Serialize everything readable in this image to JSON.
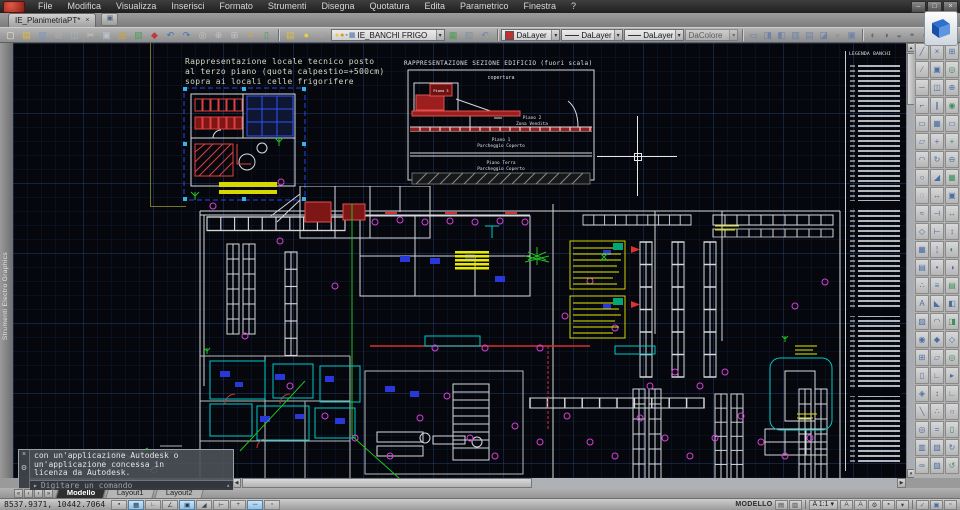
{
  "window": {
    "controls": [
      {
        "name": "minimize-button",
        "g": "–"
      },
      {
        "name": "restore-button",
        "g": "□"
      },
      {
        "name": "close-button",
        "g": "×"
      }
    ]
  },
  "menu_bar": {
    "items": [
      "File",
      "Modifica",
      "Visualizza",
      "Inserisci",
      "Formato",
      "Strumenti",
      "Disegna",
      "Quotatura",
      "Edita",
      "Parametrico",
      "Finestra",
      "?"
    ]
  },
  "document_tabs": {
    "active": "IE_PlanimetriaPT*",
    "close_glyph": "×"
  },
  "toolbar": {
    "standard_icons": [
      {
        "name": "qnew-icon",
        "g": "▢",
        "c": "#e9e5cf"
      },
      {
        "name": "open-icon",
        "g": "▤",
        "c": "#dfb93e"
      },
      {
        "name": "save-icon",
        "g": "▥",
        "c": "#7f95c4"
      },
      {
        "name": "plot-icon",
        "g": "⊟",
        "c": "#a9b0b8"
      },
      {
        "name": "plot-preview-icon",
        "g": "◫",
        "c": "#9fb4c8"
      },
      {
        "name": "cut-icon",
        "g": "✂",
        "c": "#c2c8ce"
      },
      {
        "name": "copy-icon",
        "g": "▣",
        "c": "#b9c2cb"
      },
      {
        "name": "paste-icon",
        "g": "▨",
        "c": "#c8a24a"
      },
      {
        "name": "match-properties-icon",
        "g": "▧",
        "c": "#4f9e58"
      },
      {
        "name": "block-editor-icon",
        "g": "◆",
        "c": "#c03838"
      },
      {
        "name": "undo-icon",
        "g": "↶",
        "c": "#3f6fb5"
      },
      {
        "name": "redo-icon",
        "g": "↷",
        "c": "#3f6fb5"
      },
      {
        "name": "pan-icon",
        "g": "◎",
        "c": "#c0c6cc"
      },
      {
        "name": "zoom-realtime-icon",
        "g": "⊕",
        "c": "#bfc5cb"
      },
      {
        "name": "zoom-window-icon",
        "g": "⊞",
        "c": "#bfc5cb"
      },
      {
        "name": "properties-icon",
        "g": "≡",
        "c": "#caa93f"
      },
      {
        "name": "tool-palettes-icon",
        "g": "▯",
        "c": "#4f9e58"
      }
    ],
    "layer_tools": [
      {
        "name": "layer-properties-manager-icon",
        "g": "▤",
        "c": "#d8c040"
      },
      {
        "name": "layer-bulb-icon",
        "g": "●",
        "c": "#e8d040"
      },
      {
        "name": "layer-isolate-icon",
        "g": "◐",
        "c": "#98a8b8"
      }
    ],
    "layer_dropdown": {
      "status_icons": [
        {
          "name": "layer-on-icon",
          "g": "●",
          "c": "#e8c83c"
        },
        {
          "name": "layer-freeze-icon",
          "g": "●",
          "c": "#e89020"
        },
        {
          "name": "layer-lock-icon",
          "g": "▪",
          "c": "#8a93a0"
        },
        {
          "name": "layer-color-chip",
          "g": "▦",
          "c": "#4a6fa5"
        }
      ],
      "current": "IE_BANCHI FRIGO"
    },
    "layer_tools2": [
      {
        "name": "make-object-layer-current-icon",
        "g": "▦",
        "c": "#4f9e58"
      },
      {
        "name": "layer-match-icon",
        "g": "▧",
        "c": "#8090a0"
      },
      {
        "name": "layer-previous-icon",
        "g": "↶",
        "c": "#7080b0"
      }
    ],
    "properties": {
      "color_swatch": "#c03030",
      "color": "DaLayer",
      "linetype": "DaLayer",
      "lineweight": "DaLayer",
      "plot_style": "DaColore"
    },
    "property_icons": [
      {
        "name": "pline-edit-icon",
        "g": "▭",
        "c": "#6f82a8"
      },
      {
        "name": "edit-hatch-icon",
        "g": "◨",
        "c": "#6f82a8"
      },
      {
        "name": "edit-text-icon",
        "g": "◧",
        "c": "#6f82a8"
      },
      {
        "name": "edit-attrib-icon",
        "g": "▥",
        "c": "#6f82a8"
      },
      {
        "name": "edit-block-icon",
        "g": "▤",
        "c": "#6f82a8"
      },
      {
        "name": "edit-xref-icon",
        "g": "◪",
        "c": "#6f82a8"
      },
      {
        "name": "edit-image-icon",
        "g": "▫",
        "c": "#6f82a8"
      },
      {
        "name": "edit-layout-icon",
        "g": "▣",
        "c": "#6f82a8"
      }
    ],
    "right_buttons": [
      {
        "name": "view-top-button",
        "g": "◐",
        "c": "#5a6a7a"
      },
      {
        "name": "view-bottom-button",
        "g": "◑",
        "c": "#5a6a7a"
      },
      {
        "name": "view-left-button",
        "g": "◒",
        "c": "#5a6a7a"
      },
      {
        "name": "view-right-button",
        "g": "◓",
        "c": "#5a6a7a"
      },
      {
        "name": "view-sw-button",
        "g": "○",
        "c": "#5a6a7a"
      },
      {
        "name": "view-se-button",
        "g": "●",
        "c": "#5a6a7a"
      },
      {
        "name": "view-iso-button",
        "g": "▫",
        "c": "#5a6a7a"
      }
    ]
  },
  "left_dock": {
    "title": "Strumenti Electro Graphics"
  },
  "canvas": {
    "annotation": {
      "lines": [
        "Rappresentazione locale tecnico posto",
        "al terzo piano (quota calpestio=+500cm)",
        "sopra ai locali celle frigorifere"
      ]
    },
    "section": {
      "title": "RAPPRESENTAZIONE SEZIONE EDIFICIO (fuori scala)",
      "copertura": "copertura",
      "piano3": "Piano 3",
      "piano2_l1": "Piano 2",
      "piano2_l2": "Zona Vendita",
      "piano1_l1": "Piano 1",
      "piano1_l2": "Parcheggio Coperto",
      "terra_l1": "Piano Terra",
      "terra_l2": "Parcheggio Coperto"
    },
    "legend": {
      "title": "LEGENDA BANCHI"
    },
    "command_window": {
      "lines": [
        "con un'applicazione Autodesk o",
        "un'applicazione concessa in",
        "licenza da Autodesk."
      ],
      "prompt": "Digitare un comando"
    }
  },
  "right_toolbars": {
    "col_draw": [
      {
        "n": "draw-line-icon",
        "g": "╱"
      },
      {
        "n": "draw-xline-icon",
        "g": "∕"
      },
      {
        "n": "draw-ray-icon",
        "g": "─"
      },
      {
        "n": "draw-polyline-icon",
        "g": "⌐"
      },
      {
        "n": "draw-rectangle-icon",
        "g": "▭"
      },
      {
        "n": "draw-polygon-icon",
        "g": "▱"
      },
      {
        "n": "draw-arc-icon",
        "g": "◠"
      },
      {
        "n": "draw-circle-icon",
        "g": "○"
      },
      {
        "n": "draw-revcloud-icon",
        "g": "◌"
      },
      {
        "n": "draw-spline-icon",
        "g": "≈"
      },
      {
        "n": "draw-ellipse-icon",
        "g": "◇"
      },
      {
        "n": "draw-hatch-icon",
        "g": "▦"
      },
      {
        "n": "draw-gradient-icon",
        "g": "▤"
      },
      {
        "n": "draw-point-icon",
        "g": "∴"
      },
      {
        "n": "draw-text-icon",
        "g": "A"
      },
      {
        "n": "draw-table-icon",
        "g": "▨"
      },
      {
        "n": "draw-donut-icon",
        "g": "◉"
      },
      {
        "n": "insert-block-icon",
        "g": "⊞"
      },
      {
        "n": "make-block-icon",
        "g": "▯"
      },
      {
        "n": "draw-region-icon",
        "g": "◈"
      },
      {
        "n": "draw-mline-icon",
        "g": "╲"
      },
      {
        "n": "draw-boundary-icon",
        "g": "◎"
      },
      {
        "n": "draw-wipeout-icon",
        "g": "▥"
      },
      {
        "n": "draw-helix-icon",
        "g": "∞"
      }
    ],
    "col_modify": [
      {
        "n": "erase-icon",
        "g": "×"
      },
      {
        "n": "copy-object-icon",
        "g": "▣"
      },
      {
        "n": "mirror-icon",
        "g": "◫"
      },
      {
        "n": "offset-icon",
        "g": "∥"
      },
      {
        "n": "array-icon",
        "g": "▦"
      },
      {
        "n": "move-icon",
        "g": "+"
      },
      {
        "n": "rotate-icon",
        "g": "↻"
      },
      {
        "n": "scale-icon",
        "g": "◢"
      },
      {
        "n": "stretch-icon",
        "g": "↔"
      },
      {
        "n": "trim-icon",
        "g": "⊣"
      },
      {
        "n": "extend-icon",
        "g": "⊢"
      },
      {
        "n": "break-icon",
        "g": "¦"
      },
      {
        "n": "break-at-point-icon",
        "g": "•"
      },
      {
        "n": "join-icon",
        "g": "≡"
      },
      {
        "n": "chamfer-icon",
        "g": "◣"
      },
      {
        "n": "fillet-icon",
        "g": "◠"
      },
      {
        "n": "explode-icon",
        "g": "◆"
      },
      {
        "n": "pedit-icon",
        "g": "▱"
      },
      {
        "n": "align-icon",
        "g": "∟"
      },
      {
        "n": "lengthen-icon",
        "g": "↕"
      },
      {
        "n": "divide-icon",
        "g": "∴"
      },
      {
        "n": "measure-icon",
        "g": "="
      },
      {
        "n": "group-icon",
        "g": "▧"
      },
      {
        "n": "ungroup-icon",
        "g": "▨"
      }
    ],
    "col_view": [
      {
        "n": "zoom-window-tool-icon",
        "g": "⊞"
      },
      {
        "n": "zoom-dynamic-icon",
        "g": "◎"
      },
      {
        "n": "zoom-scale-icon",
        "g": "⊕"
      },
      {
        "n": "zoom-center-icon",
        "g": "◉"
      },
      {
        "n": "zoom-object-icon",
        "g": "▭"
      },
      {
        "n": "zoom-in-icon",
        "g": "+"
      },
      {
        "n": "zoom-out-icon",
        "g": "⊖"
      },
      {
        "n": "zoom-all-icon",
        "g": "▦"
      },
      {
        "n": "zoom-extents-icon",
        "g": "▣"
      },
      {
        "n": "pan-horizontal-icon",
        "g": "↔"
      },
      {
        "n": "pan-vertical-icon",
        "g": "↕"
      },
      {
        "n": "orbit-icon",
        "g": "◐"
      },
      {
        "n": "free-orbit-icon",
        "g": "◑"
      },
      {
        "n": "named-views-icon",
        "g": "▤"
      },
      {
        "n": "front-view-icon",
        "g": "◧"
      },
      {
        "n": "top-view-icon",
        "g": "◨"
      },
      {
        "n": "visual-styles-icon",
        "g": "◇"
      },
      {
        "n": "steering-wheel-icon",
        "g": "◎"
      },
      {
        "n": "show-motion-icon",
        "g": "▸"
      },
      {
        "n": "ucs-icon",
        "g": "∟"
      },
      {
        "n": "ucs-world-icon",
        "g": "○"
      },
      {
        "n": "viewport-icon",
        "g": "▯"
      },
      {
        "n": "regen-icon",
        "g": "↻"
      },
      {
        "n": "redraw-icon",
        "g": "↺"
      }
    ]
  },
  "layout_tabs": {
    "nav": [
      {
        "name": "first-tab-button",
        "g": "«"
      },
      {
        "name": "prev-tab-button",
        "g": "‹"
      },
      {
        "name": "next-tab-button",
        "g": "›"
      },
      {
        "name": "last-tab-button",
        "g": "»"
      }
    ],
    "items": [
      {
        "label": "Modello",
        "active": true
      },
      {
        "label": "Layout1"
      },
      {
        "label": "Layout2"
      }
    ]
  },
  "status_bar": {
    "coordinates": "8537.9371, 10442.7064",
    "toggles": [
      {
        "name": "snap-toggle",
        "g": "▪"
      },
      {
        "name": "grid-toggle",
        "g": "▦",
        "pressed": true
      },
      {
        "name": "ortho-toggle",
        "g": "∟"
      },
      {
        "name": "polar-toggle",
        "g": "∠"
      },
      {
        "name": "osnap-toggle",
        "g": "▣",
        "pressed": true
      },
      {
        "name": "otrack-toggle",
        "g": "◢"
      },
      {
        "name": "ducs-toggle",
        "g": "⊢"
      },
      {
        "name": "dyn-toggle",
        "g": "+"
      },
      {
        "name": "lwt-toggle",
        "g": "─",
        "pressed": true
      },
      {
        "name": "qp-toggle",
        "g": "▫"
      }
    ],
    "model_label": "MODELLO",
    "scale_label": "A 1:1",
    "space_icons": [
      {
        "name": "model-space-button",
        "g": "▤"
      },
      {
        "name": "layout-space-button",
        "g": "▥"
      }
    ],
    "annotation_icons": [
      {
        "name": "annotation-visibility-button",
        "g": "A"
      },
      {
        "name": "annotation-autoscale-button",
        "g": "A"
      },
      {
        "name": "workspace-switching-button",
        "g": "⚙"
      },
      {
        "name": "toolbar-lock-button",
        "g": "▪"
      },
      {
        "name": "status-tray-menu-button",
        "g": "▾"
      }
    ],
    "tray_icons": [
      {
        "name": "tray-check-icon",
        "g": "✓",
        "c": "#3c8c3c"
      },
      {
        "name": "tray-plotter-icon",
        "g": "▣",
        "c": "#4a6fa5"
      },
      {
        "name": "clean-screen-button",
        "g": "▫",
        "c": "#444444"
      }
    ]
  },
  "icons": {
    "dd_arrow": "▾",
    "scroll_up": "▴",
    "scroll_down": "▾",
    "scroll_left": "◀",
    "scroll_right": "▶",
    "prompt_arrow": "▸",
    "cmd_close": "×",
    "cmd_tool": "⚙",
    "new_tab": "▣"
  }
}
